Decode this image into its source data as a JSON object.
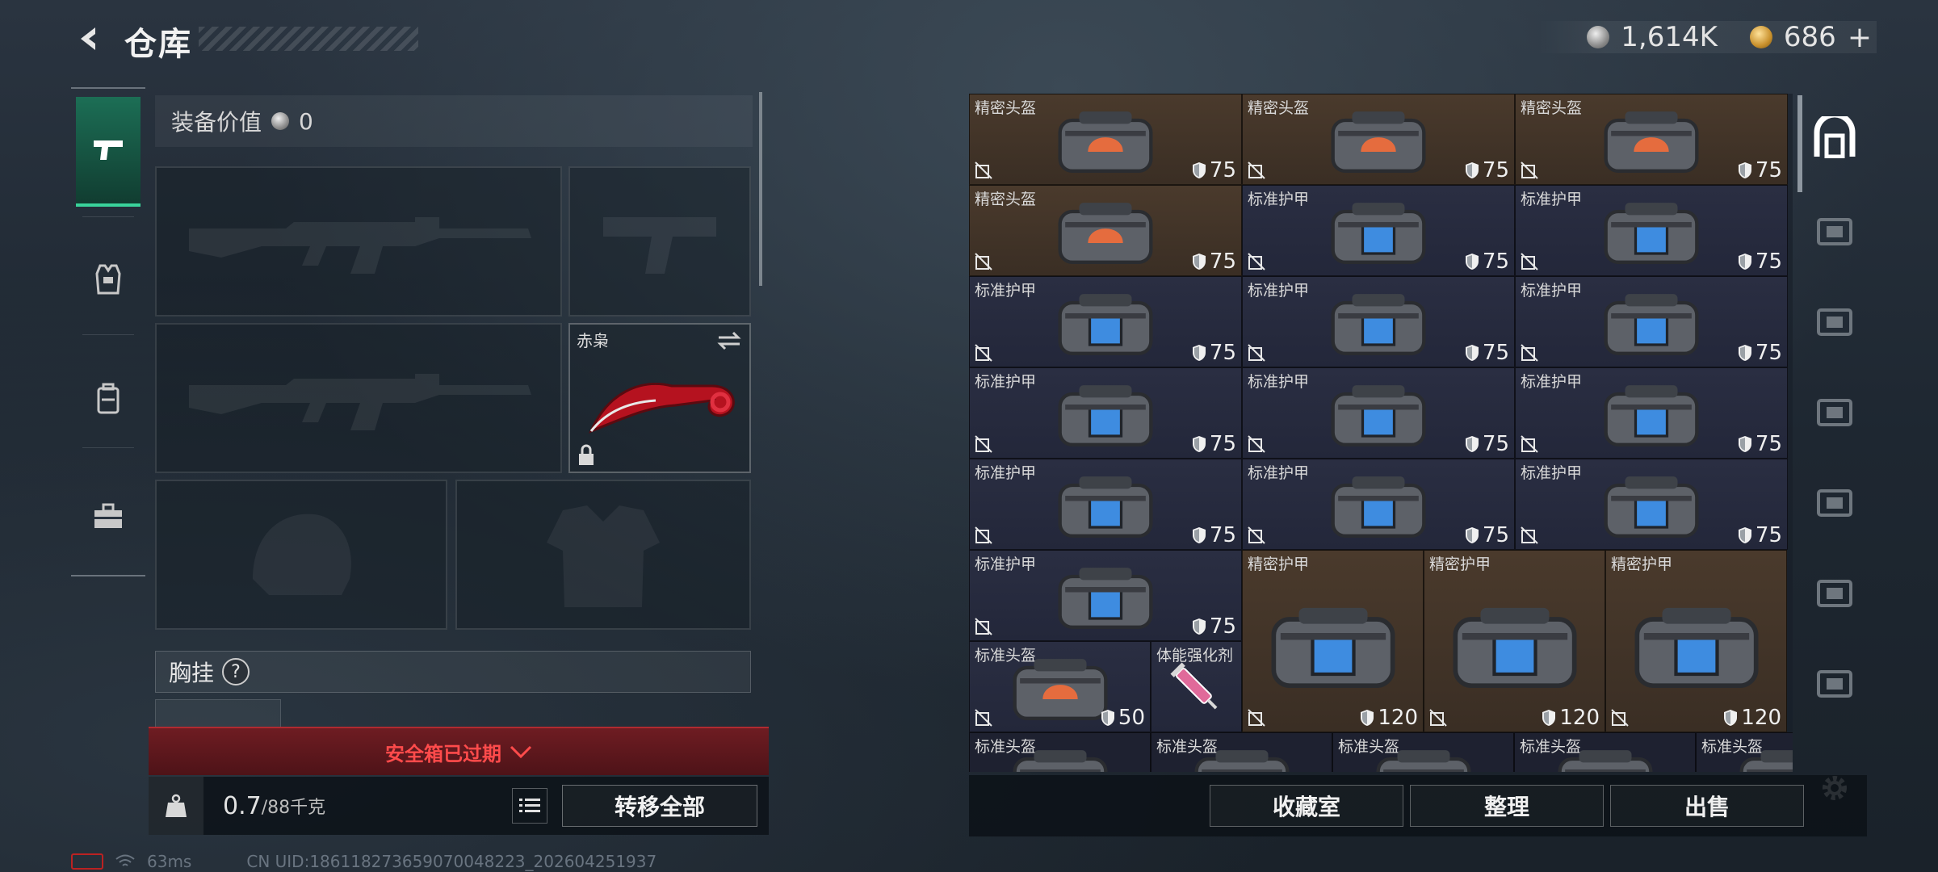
{
  "header": {
    "title": "仓库"
  },
  "currency": {
    "silver": "1,614K",
    "gold": "686",
    "plus": "+"
  },
  "loadout": {
    "equip_value_label": "装备价值",
    "equip_value": "0",
    "melee_name": "赤枭",
    "vest_label": "胸挂",
    "vest_help": "?"
  },
  "safebox": {
    "expired_label": "安全箱已过期"
  },
  "weight": {
    "current": "0.7",
    "max": "/88千克"
  },
  "actions": {
    "transfer_all": "转移全部",
    "collection": "收藏室",
    "organize": "整理",
    "sell": "出售"
  },
  "status": {
    "ping": "63ms",
    "uid": "CN UID:1861182736590700482​23_202604251937"
  },
  "storage": {
    "items": [
      {
        "name": "精密头盔",
        "durability": "75",
        "kind": "helmet",
        "tier": "brown"
      },
      {
        "name": "精密头盔",
        "durability": "75",
        "kind": "helmet",
        "tier": "brown"
      },
      {
        "name": "精密头盔",
        "durability": "75",
        "kind": "helmet",
        "tier": "brown"
      },
      {
        "name": "精密头盔",
        "durability": "75",
        "kind": "helmet",
        "tier": "brown"
      },
      {
        "name": "标准护甲",
        "durability": "75",
        "kind": "armor",
        "tier": "navy"
      },
      {
        "name": "标准护甲",
        "durability": "75",
        "kind": "armor",
        "tier": "navy"
      },
      {
        "name": "标准护甲",
        "durability": "75",
        "kind": "armor",
        "tier": "navy"
      },
      {
        "name": "标准护甲",
        "durability": "75",
        "kind": "armor",
        "tier": "navy"
      },
      {
        "name": "标准护甲",
        "durability": "75",
        "kind": "armor",
        "tier": "navy"
      },
      {
        "name": "标准护甲",
        "durability": "75",
        "kind": "armor",
        "tier": "navy"
      },
      {
        "name": "标准护甲",
        "durability": "75",
        "kind": "armor",
        "tier": "navy"
      },
      {
        "name": "标准护甲",
        "durability": "75",
        "kind": "armor",
        "tier": "navy"
      },
      {
        "name": "标准护甲",
        "durability": "75",
        "kind": "armor",
        "tier": "navy"
      },
      {
        "name": "标准护甲",
        "durability": "75",
        "kind": "armor",
        "tier": "navy"
      },
      {
        "name": "标准护甲",
        "durability": "75",
        "kind": "armor",
        "tier": "navy"
      },
      {
        "name": "标准护甲",
        "durability": "75",
        "kind": "armor",
        "tier": "navy"
      },
      {
        "name": "精密护甲",
        "durability": "120",
        "kind": "armor-large",
        "tier": "brown"
      },
      {
        "name": "精密护甲",
        "durability": "120",
        "kind": "armor-large",
        "tier": "brown"
      },
      {
        "name": "精密护甲",
        "durability": "120",
        "kind": "armor-large",
        "tier": "brown"
      },
      {
        "name": "标准头盔",
        "durability": "50",
        "kind": "helmet",
        "tier": "navy"
      },
      {
        "name": "体能强化剂",
        "durability": "",
        "kind": "syringe",
        "tier": "navy"
      },
      {
        "name": "标准头盔",
        "durability": "",
        "kind": "helmet",
        "tier": "dark"
      },
      {
        "name": "标准头盔",
        "durability": "",
        "kind": "helmet",
        "tier": "dark"
      },
      {
        "name": "标准头盔",
        "durability": "",
        "kind": "helmet",
        "tier": "dark"
      },
      {
        "name": "标准头盔",
        "durability": "",
        "kind": "helmet",
        "tier": "dark"
      },
      {
        "name": "标准头盔",
        "durability": "",
        "kind": "helmet",
        "tier": "dark"
      }
    ]
  },
  "right_rail": {
    "icons": [
      "warehouse-icon",
      "gti-container-icon",
      "iv-container-icon",
      "iv-container-2-icon",
      "v-container-icon",
      "v-container-2-icon",
      "iv-container-3-icon"
    ]
  },
  "colors": {
    "accent_green": "#39d39b",
    "expired_red": "#ff4b4b",
    "tier_brown": "#4a3a2c",
    "tier_navy": "#2a2e42"
  }
}
